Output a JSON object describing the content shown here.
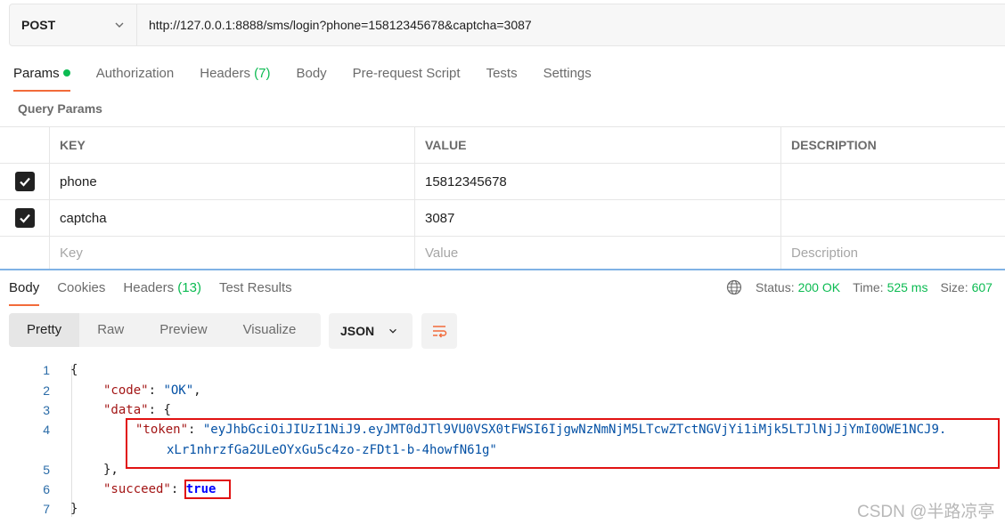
{
  "request": {
    "method": "POST",
    "url": "http://127.0.0.1:8888/sms/login?phone=15812345678&captcha=3087"
  },
  "request_tabs": [
    {
      "label": "Params",
      "active": true
    },
    {
      "label": "Authorization"
    },
    {
      "label": "Headers",
      "count": "(7)"
    },
    {
      "label": "Body"
    },
    {
      "label": "Pre-request Script"
    },
    {
      "label": "Tests"
    },
    {
      "label": "Settings"
    }
  ],
  "query_params": {
    "title": "Query Params",
    "columns": [
      "KEY",
      "VALUE",
      "DESCRIPTION"
    ],
    "rows": [
      {
        "checked": true,
        "key": "phone",
        "value": "15812345678",
        "description": ""
      },
      {
        "checked": true,
        "key": "captcha",
        "value": "3087",
        "description": ""
      }
    ],
    "placeholders": {
      "key": "Key",
      "value": "Value",
      "description": "Description"
    }
  },
  "response_tabs": [
    {
      "label": "Body",
      "active": true
    },
    {
      "label": "Cookies"
    },
    {
      "label": "Headers",
      "count": "(13)"
    },
    {
      "label": "Test Results"
    }
  ],
  "status": {
    "status_label": "Status:",
    "status_value": "200 OK",
    "time_label": "Time:",
    "time_value": "525 ms",
    "size_label": "Size:",
    "size_value": "607"
  },
  "view_modes": [
    "Pretty",
    "Raw",
    "Preview",
    "Visualize"
  ],
  "active_view": "Pretty",
  "format": "JSON",
  "code": {
    "line_numbers": [
      "1",
      "2",
      "3",
      "4",
      "5",
      "6",
      "7"
    ],
    "open_brace": "{",
    "code_key": "\"code\"",
    "code_value": "\"OK\"",
    "data_key": "\"data\"",
    "data_open": "{",
    "token_key": "\"token\"",
    "token_value_line1": "\"eyJhbGciOiJIUzI1NiJ9.eyJMT0dJTl9VU0VSX0tFWSI6IjgwNzNmNjM5LTcwZTctNGVjYi1iMjk5LTJlNjJjYmI0OWE1NCJ9.",
    "token_value_line2": "xLr1nhrzfGa2ULeOYxGu5c4zo-zFDt1-b-4howfN61g\"",
    "data_close": "},",
    "succeed_key": "\"succeed\"",
    "succeed_value": "true",
    "close_brace": "}"
  },
  "watermark": "CSDN @半路凉亭",
  "colors": {
    "accent": "#f26b3a",
    "success": "#0cbb52",
    "highlight_box": "#e11212",
    "json_key": "#a31515",
    "json_string": "#0451a5"
  },
  "icons": [
    "chevron-down-icon",
    "checkmark-icon",
    "globe-icon",
    "wrap-lines-icon"
  ]
}
